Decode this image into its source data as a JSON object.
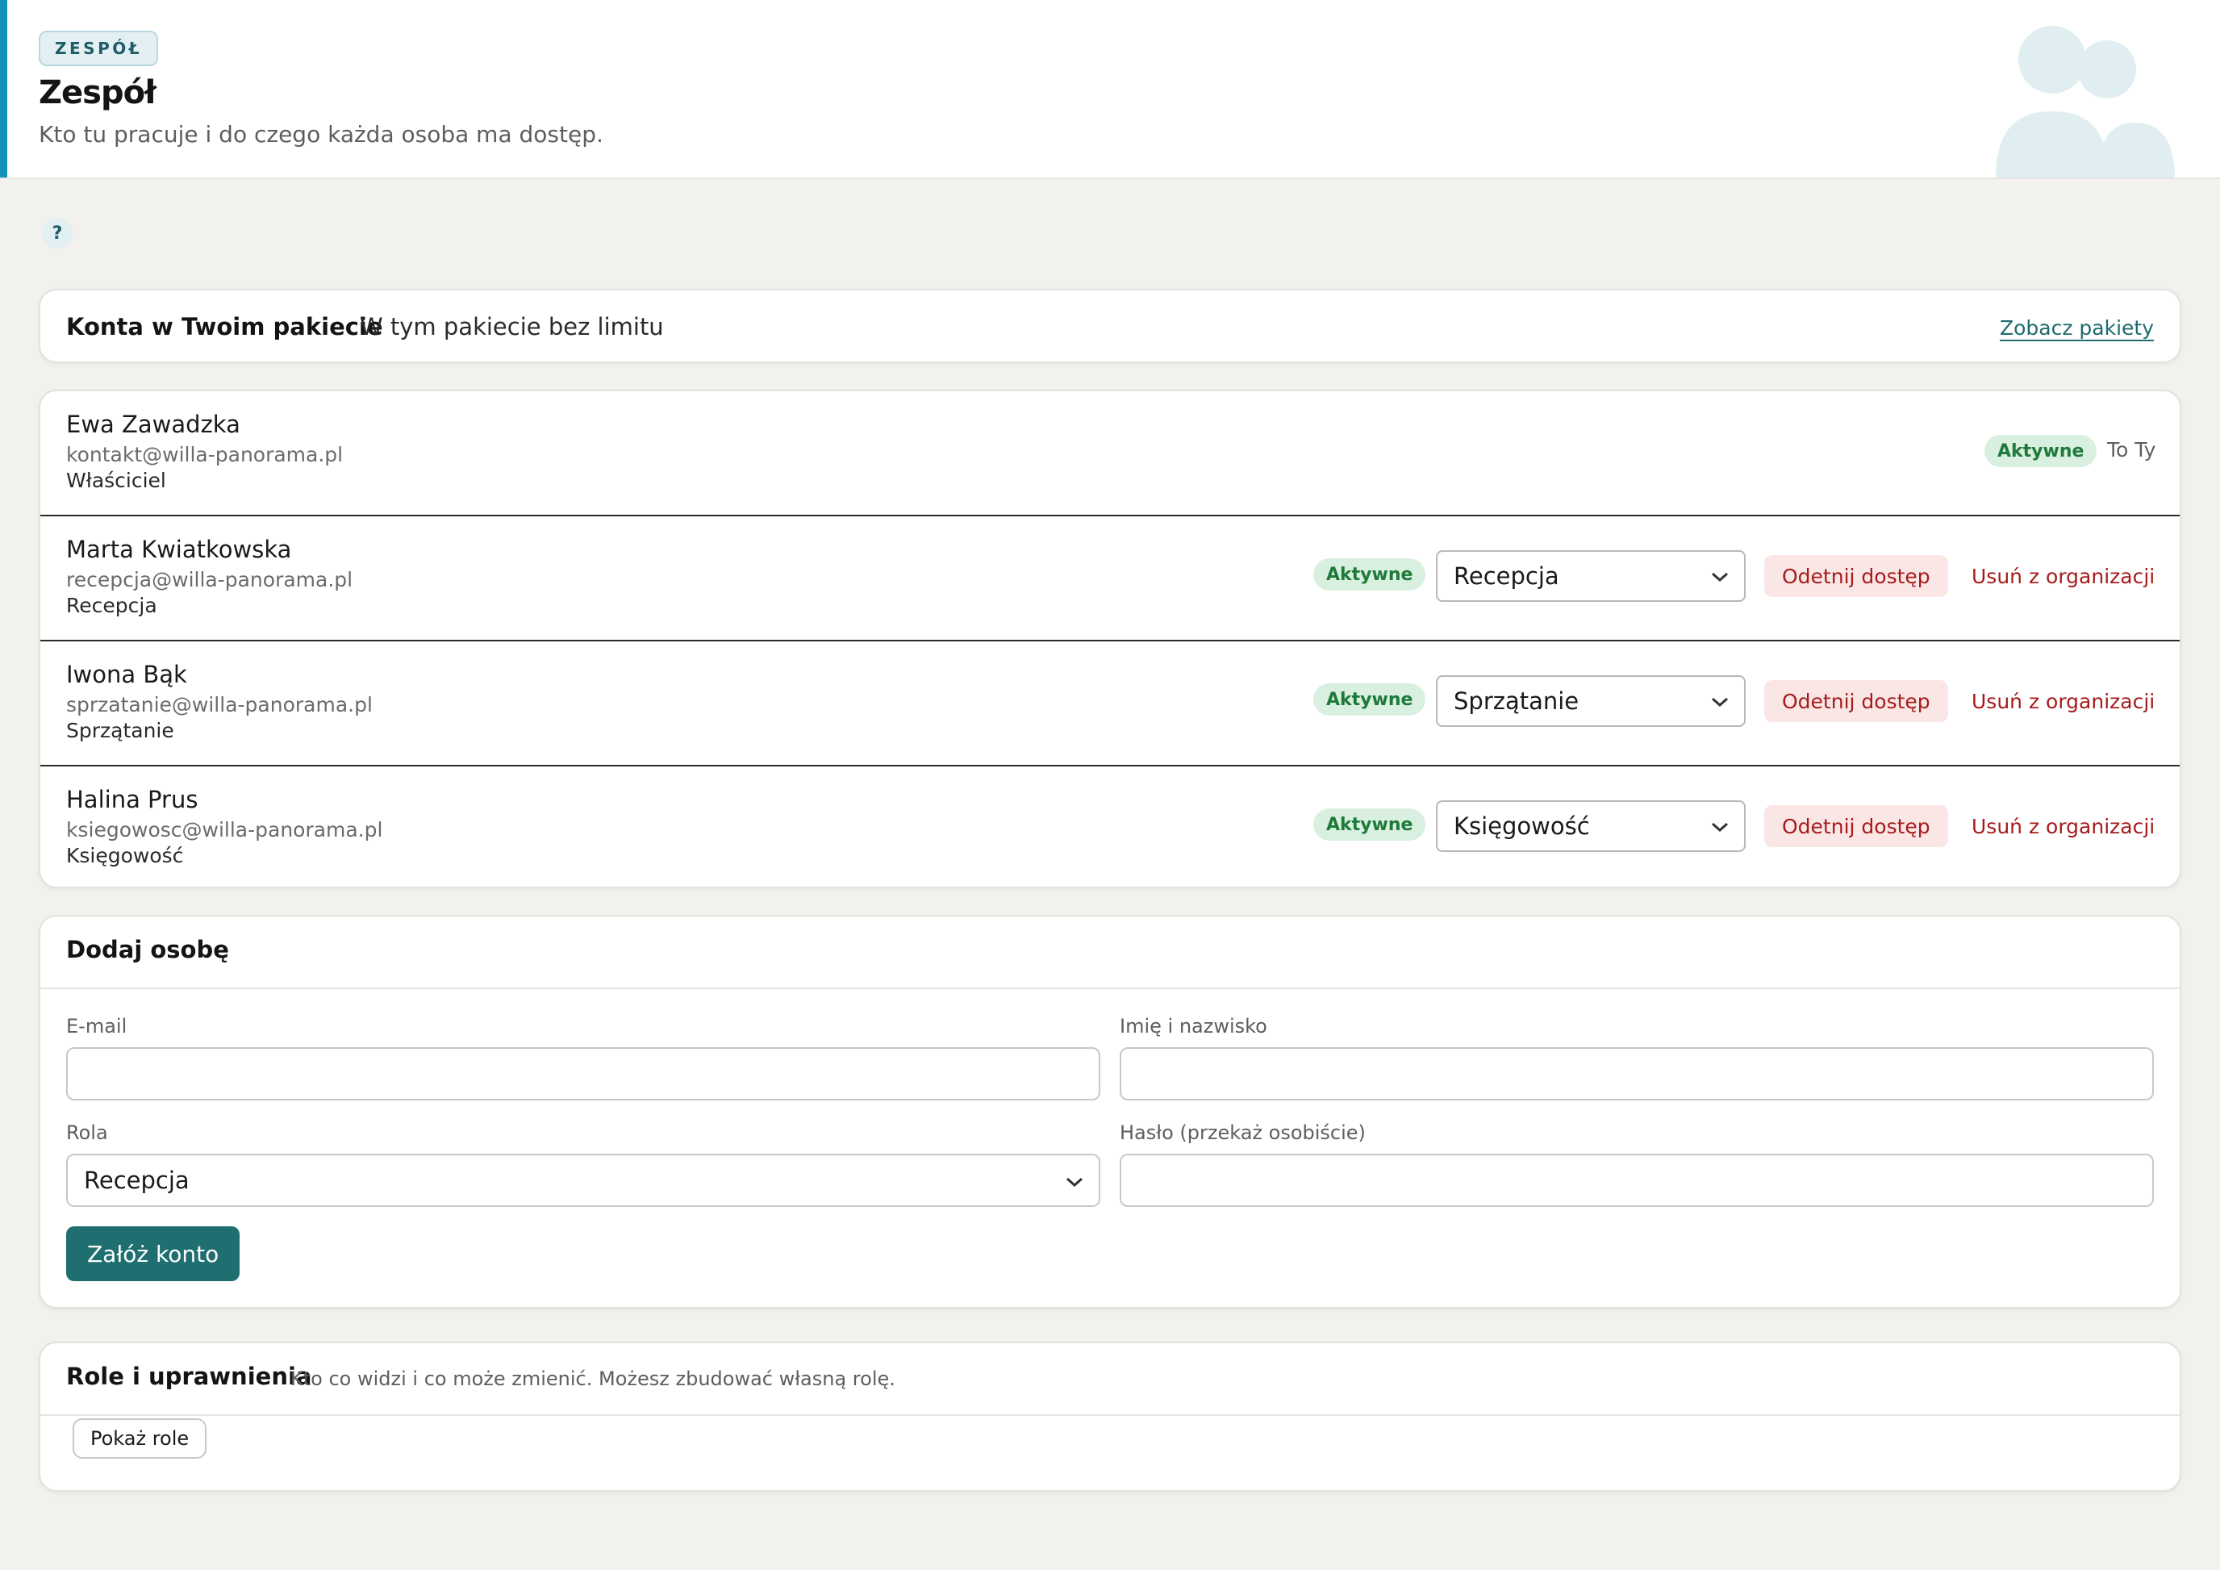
{
  "header": {
    "eyebrow": "ZESPÓŁ",
    "title": "Zespół",
    "subtitle": "Kto tu pracuje i do czego każda osoba ma dostęp."
  },
  "help": {
    "label": "?"
  },
  "package": {
    "title": "Konta w Twoim pakiecie",
    "limit_text": "W tym pakiecie bez limitu",
    "link": "Zobacz pakiety"
  },
  "members": [
    {
      "name": "Ewa Zawadzka",
      "email": "kontakt@willa-panorama.pl",
      "role": "Właściciel",
      "status": "Aktywne",
      "note": "To Ty"
    },
    {
      "name": "Marta Kwiatkowska",
      "email": "recepcja@willa-panorama.pl",
      "role": "Recepcja",
      "status": "Aktywne",
      "selected_role": "Recepcja",
      "cut_label": "Odetnij dostęp",
      "remove_label": "Usuń z organizacji"
    },
    {
      "name": "Iwona Bąk",
      "email": "sprzatanie@willa-panorama.pl",
      "role": "Sprzątanie",
      "status": "Aktywne",
      "selected_role": "Sprzątanie",
      "cut_label": "Odetnij dostęp",
      "remove_label": "Usuń z organizacji"
    },
    {
      "name": "Halina Prus",
      "email": "ksiegowosc@willa-panorama.pl",
      "role": "Księgowość",
      "status": "Aktywne",
      "selected_role": "Księgowość",
      "cut_label": "Odetnij dostęp",
      "remove_label": "Usuń z organizacji"
    }
  ],
  "add_person": {
    "title": "Dodaj osobę",
    "email_label": "E-mail",
    "email_value": "",
    "name_label": "Imię i nazwisko",
    "name_value": "",
    "role_label": "Rola",
    "role_value": "Recepcja",
    "password_label": "Hasło (przekaż osobiście)",
    "password_value": "",
    "submit_label": "Załóż konto"
  },
  "roles": {
    "title": "Role i uprawnienia",
    "description": "Kto co widzi i co może zmienić. Możesz zbudować własną rolę.",
    "show_label": "Pokaż role"
  },
  "colors": {
    "accent": "#1290b8",
    "primary_button": "#1f6e70",
    "status_active_bg": "#d9efdf",
    "status_active_text": "#1e7a3a",
    "danger": "#a61c1c",
    "danger_bg": "#fbe6e6"
  },
  "icons": {
    "header_illustration": "people-icon",
    "dropdown": "chevron-down-icon"
  }
}
